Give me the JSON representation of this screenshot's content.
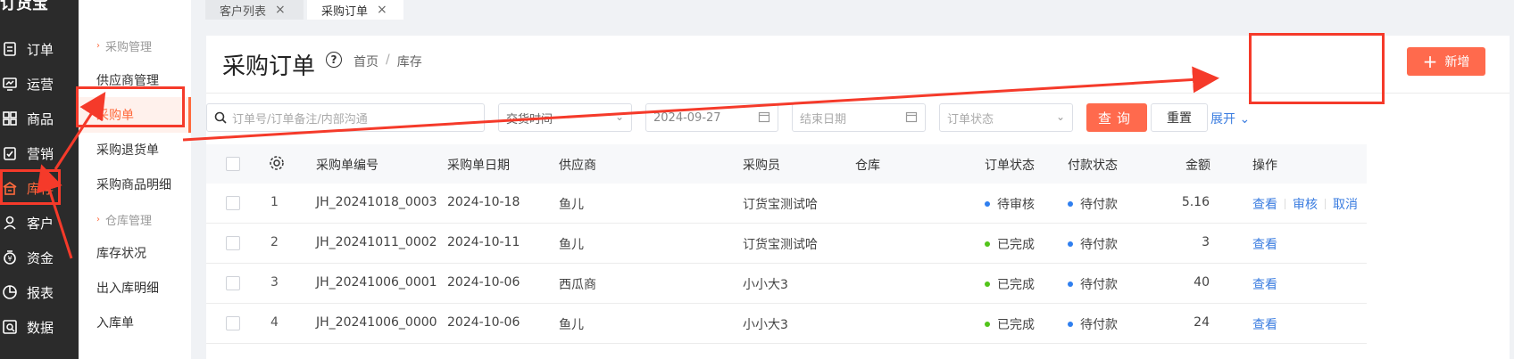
{
  "rail": {
    "logo": "订货宝",
    "items": [
      {
        "label": "订单",
        "icon": "order-icon"
      },
      {
        "label": "运营",
        "icon": "operation-icon"
      },
      {
        "label": "商品",
        "icon": "goods-icon"
      },
      {
        "label": "营销",
        "icon": "marketing-icon"
      },
      {
        "label": "库存",
        "icon": "warehouse-icon",
        "active": true
      },
      {
        "label": "客户",
        "icon": "customer-icon"
      },
      {
        "label": "资金",
        "icon": "money-icon"
      },
      {
        "label": "报表",
        "icon": "report-icon"
      },
      {
        "label": "数据",
        "icon": "data-icon"
      }
    ]
  },
  "submenu": {
    "group1": "采购管理",
    "items1": [
      "供应商管理",
      "采购单",
      "采购退货单",
      "采购商品明细"
    ],
    "group2": "仓库管理",
    "items2": [
      "库存状况",
      "出入库明细",
      "入库单"
    ]
  },
  "tabs": [
    {
      "label": "客户列表",
      "close": "×"
    },
    {
      "label": "采购订单",
      "close": "×"
    }
  ],
  "page": {
    "title": "采购订单",
    "help": "?",
    "breadcrumb": [
      "首页",
      "库存"
    ],
    "add_button": "新增",
    "add_plus": "+"
  },
  "filters": {
    "search_placeholder": "订单号/订单备注/内部沟通",
    "date_type": "交货时间",
    "start_date": "2024-09-27",
    "end_placeholder": "结束日期",
    "status_placeholder": "订单状态",
    "query": "查询",
    "reset": "重置",
    "expand": "展开"
  },
  "table": {
    "headers": [
      "采购单编号",
      "采购单日期",
      "供应商",
      "采购员",
      "仓库",
      "订单状态",
      "付款状态",
      "金额",
      "操作"
    ],
    "rows": [
      {
        "idx": "1",
        "no": "JH_20241018_0003",
        "date": "2024-10-18",
        "supplier": "鱼儿",
        "buyer": "订货宝测试哈",
        "warehouse": "",
        "order_status": "待审核",
        "order_dot": "blue",
        "pay_status": "待付款",
        "amount": "5.16",
        "ops": [
          "查看",
          "审核",
          "取消"
        ]
      },
      {
        "idx": "2",
        "no": "JH_20241011_0002",
        "date": "2024-10-11",
        "supplier": "鱼儿",
        "buyer": "订货宝测试哈",
        "warehouse": "",
        "order_status": "已完成",
        "order_dot": "green",
        "pay_status": "待付款",
        "amount": "3",
        "ops": [
          "查看"
        ]
      },
      {
        "idx": "3",
        "no": "JH_20241006_0001",
        "date": "2024-10-06",
        "supplier": "西瓜商",
        "buyer": "小小大3",
        "warehouse": "",
        "order_status": "已完成",
        "order_dot": "green",
        "pay_status": "待付款",
        "amount": "40",
        "ops": [
          "查看"
        ]
      },
      {
        "idx": "4",
        "no": "JH_20241006_0000",
        "date": "2024-10-06",
        "supplier": "鱼儿",
        "buyer": "小小大3",
        "warehouse": "",
        "order_status": "已完成",
        "order_dot": "green",
        "pay_status": "待付款",
        "amount": "24",
        "ops": [
          "查看"
        ]
      }
    ]
  },
  "colors": {
    "accent": "#ff6a4d",
    "annotation": "#f53a2a",
    "link": "#3b7de0",
    "rail_bg": "#2b2b2b"
  }
}
